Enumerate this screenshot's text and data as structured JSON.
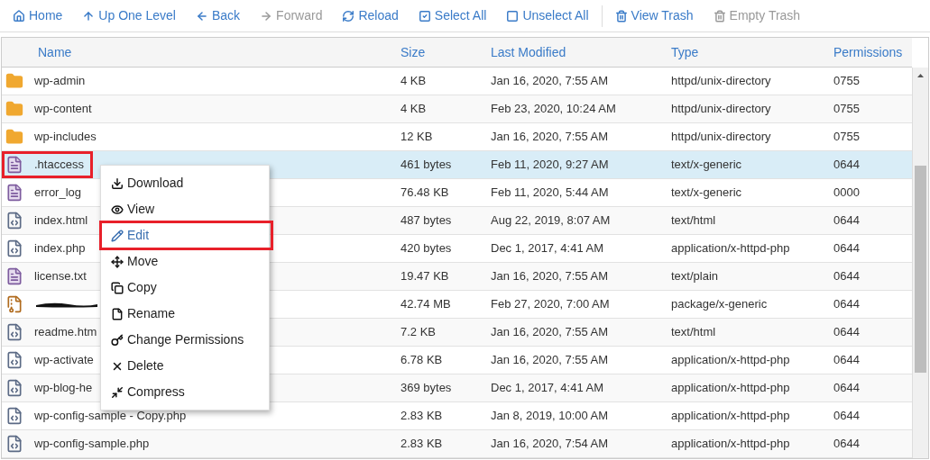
{
  "toolbar": [
    {
      "label": "Home",
      "kind": "home",
      "disabled": false
    },
    {
      "label": "Up One Level",
      "kind": "up",
      "disabled": false
    },
    {
      "label": "Back",
      "kind": "back",
      "disabled": false
    },
    {
      "label": "Forward",
      "kind": "forward",
      "disabled": true
    },
    {
      "label": "Reload",
      "kind": "reload",
      "disabled": false
    },
    {
      "label": "Select All",
      "kind": "check",
      "disabled": false
    },
    {
      "label": "Unselect All",
      "kind": "square",
      "disabled": false
    },
    {
      "label": "View Trash",
      "kind": "trash",
      "disabled": false
    },
    {
      "label": "Empty Trash",
      "kind": "trash",
      "disabled": true
    }
  ],
  "table": {
    "columns": [
      "Name",
      "Size",
      "Last Modified",
      "Type",
      "Permissions"
    ],
    "rows": [
      {
        "kind": "folder",
        "name": "wp-admin",
        "size": "4 KB",
        "modified": "Jan 16, 2020, 7:55 AM",
        "type": "httpd/unix-directory",
        "permissions": "0755",
        "selected": false,
        "highlighted": false
      },
      {
        "kind": "folder",
        "name": "wp-content",
        "size": "4 KB",
        "modified": "Feb 23, 2020, 10:24 AM",
        "type": "httpd/unix-directory",
        "permissions": "0755",
        "selected": false,
        "highlighted": false
      },
      {
        "kind": "folder",
        "name": "wp-includes",
        "size": "12 KB",
        "modified": "Jan 16, 2020, 7:55 AM",
        "type": "httpd/unix-directory",
        "permissions": "0755",
        "selected": false,
        "highlighted": false
      },
      {
        "kind": "text",
        "name": ".htaccess",
        "size": "461 bytes",
        "modified": "Feb 11, 2020, 9:27 AM",
        "type": "text/x-generic",
        "permissions": "0644",
        "selected": true,
        "highlighted": true
      },
      {
        "kind": "text",
        "name": "error_log",
        "size": "76.48 KB",
        "modified": "Feb 11, 2020, 5:44 AM",
        "type": "text/x-generic",
        "permissions": "0000",
        "selected": false,
        "highlighted": false
      },
      {
        "kind": "code",
        "name": "index.html",
        "size": "487 bytes",
        "modified": "Aug 22, 2019, 8:07 AM",
        "type": "text/html",
        "permissions": "0644",
        "selected": false,
        "highlighted": false
      },
      {
        "kind": "code",
        "name": "index.php",
        "size": "420 bytes",
        "modified": "Dec 1, 2017, 4:41 AM",
        "type": "application/x-httpd-php",
        "permissions": "0644",
        "selected": false,
        "highlighted": false
      },
      {
        "kind": "text",
        "name": "license.txt",
        "size": "19.47 KB",
        "modified": "Jan 16, 2020, 7:55 AM",
        "type": "text/plain",
        "permissions": "0644",
        "selected": false,
        "highlighted": false
      },
      {
        "kind": "archive",
        "redacted": true,
        "size": "42.74 MB",
        "modified": "Feb 27, 2020, 7:00 AM",
        "type": "package/x-generic",
        "permissions": "0644",
        "selected": false,
        "highlighted": false
      },
      {
        "kind": "code",
        "name": "readme.htm",
        "size": "7.2 KB",
        "modified": "Jan 16, 2020, 7:55 AM",
        "type": "text/html",
        "permissions": "0644",
        "selected": false,
        "highlighted": false
      },
      {
        "kind": "code",
        "name": "wp-activate",
        "size": "6.78 KB",
        "modified": "Jan 16, 2020, 7:55 AM",
        "type": "application/x-httpd-php",
        "permissions": "0644",
        "selected": false,
        "highlighted": false
      },
      {
        "kind": "code",
        "name": "wp-blog-he",
        "size": "369 bytes",
        "modified": "Dec 1, 2017, 4:41 AM",
        "type": "application/x-httpd-php",
        "permissions": "0644",
        "selected": false,
        "highlighted": false
      },
      {
        "kind": "code",
        "name": "wp-config-sample - Copy.php",
        "size": "2.83 KB",
        "modified": "Jan 8, 2019, 10:00 AM",
        "type": "application/x-httpd-php",
        "permissions": "0644",
        "selected": false,
        "highlighted": false
      },
      {
        "kind": "code",
        "name": "wp-config-sample.php",
        "size": "2.83 KB",
        "modified": "Jan 16, 2020, 7:54 AM",
        "type": "application/x-httpd-php",
        "permissions": "0644",
        "selected": false,
        "highlighted": false
      }
    ]
  },
  "context_menu": [
    {
      "label": "Download",
      "kind": "download",
      "highlighted": false
    },
    {
      "label": "View",
      "kind": "eye",
      "highlighted": false
    },
    {
      "label": "Edit",
      "kind": "pencil",
      "highlighted": true
    },
    {
      "label": "Move",
      "kind": "move",
      "highlighted": false
    },
    {
      "label": "Copy",
      "kind": "copy",
      "highlighted": false
    },
    {
      "label": "Rename",
      "kind": "file",
      "highlighted": false
    },
    {
      "label": "Change Permissions",
      "kind": "key",
      "highlighted": false
    },
    {
      "label": "Delete",
      "kind": "x",
      "highlighted": false
    },
    {
      "label": "Compress",
      "kind": "compress",
      "highlighted": false
    }
  ]
}
